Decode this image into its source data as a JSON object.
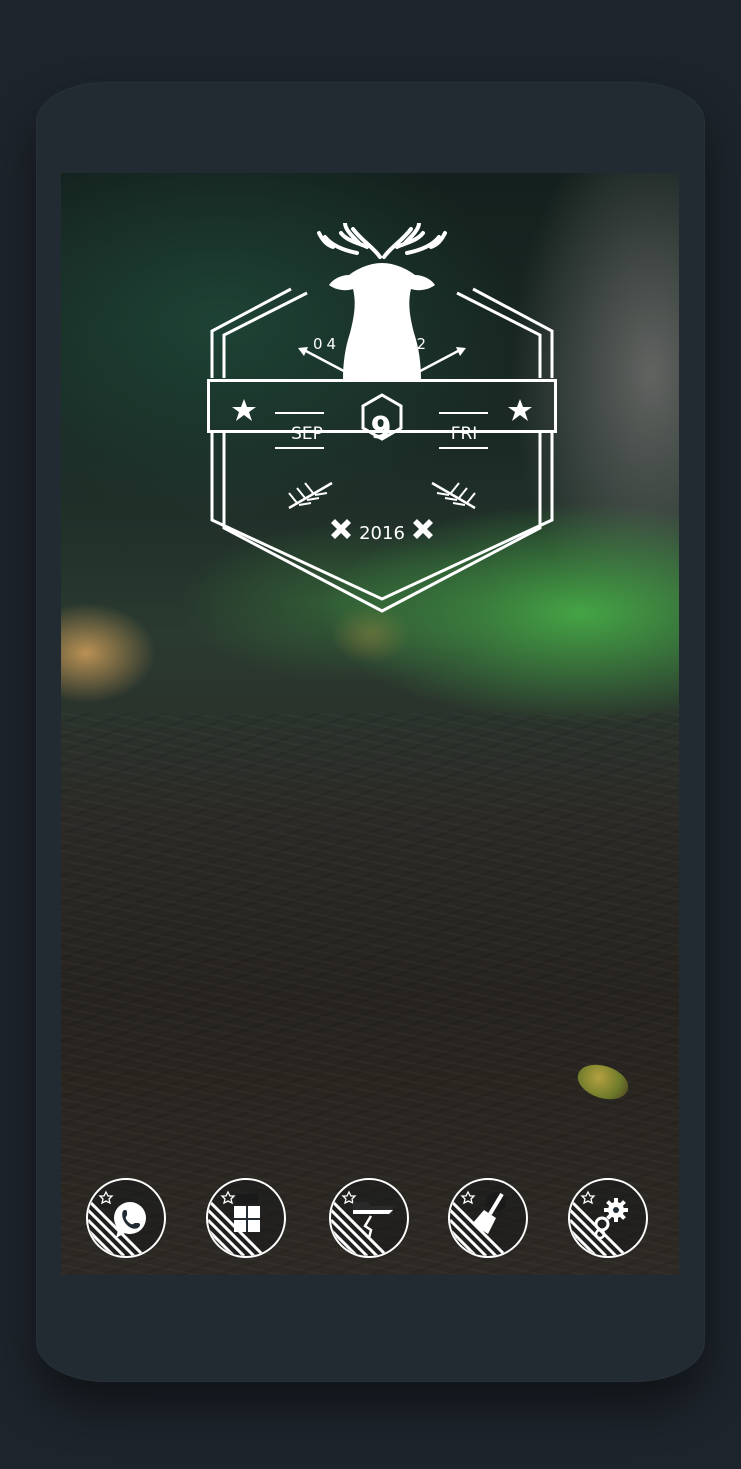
{
  "clock_widget": {
    "hour": "04",
    "minute": "42",
    "month": "SEP",
    "day": "9",
    "weekday": "FRI",
    "year": "2016"
  },
  "dock": {
    "apps": [
      {
        "name": "phone",
        "icon": "phone-icon"
      },
      {
        "name": "apps",
        "icon": "apps-grid-icon"
      },
      {
        "name": "files",
        "icon": "folder-icon"
      },
      {
        "name": "cleaner",
        "icon": "broom-icon"
      },
      {
        "name": "settings",
        "icon": "gear-icon"
      }
    ]
  },
  "colors": {
    "device_frame": "#222a32",
    "page_background": "#1d242b",
    "widget_foreground": "#ffffff"
  }
}
